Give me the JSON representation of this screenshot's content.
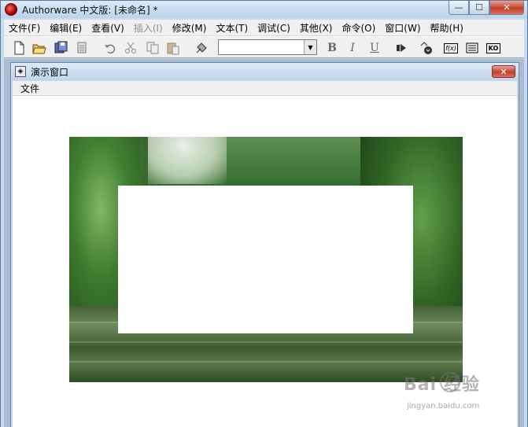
{
  "window": {
    "title": "Authorware 中文版: [未命名] *",
    "minimize": "—",
    "maximize": "☐",
    "close": "✕"
  },
  "menubar": {
    "items": [
      {
        "label": "文件(F)",
        "enabled": true
      },
      {
        "label": "编辑(E)",
        "enabled": true
      },
      {
        "label": "查看(V)",
        "enabled": true
      },
      {
        "label": "插入(I)",
        "enabled": false
      },
      {
        "label": "修改(M)",
        "enabled": true
      },
      {
        "label": "文本(T)",
        "enabled": true
      },
      {
        "label": "调试(C)",
        "enabled": true
      },
      {
        "label": "其他(X)",
        "enabled": true
      },
      {
        "label": "命令(O)",
        "enabled": true
      },
      {
        "label": "窗口(W)",
        "enabled": true
      },
      {
        "label": "帮助(H)",
        "enabled": true
      }
    ]
  },
  "toolbar": {
    "style_combo_value": "",
    "bold_label": "B",
    "italic_label": "I",
    "underline_label": "U",
    "function_label": "f(x)",
    "ko_label": "KO"
  },
  "presentation_window": {
    "title": "演示窗口",
    "close": "✕",
    "menu": [
      {
        "label": "文件"
      }
    ]
  },
  "watermark": {
    "brand": "Bai 经验",
    "url": "jingyan.baidu.com"
  },
  "colors": {
    "titlebar": "#bcd3ec",
    "menu_bg": "#f0f0f0",
    "close_red": "#c6402a",
    "canvas": "#ffffff"
  }
}
